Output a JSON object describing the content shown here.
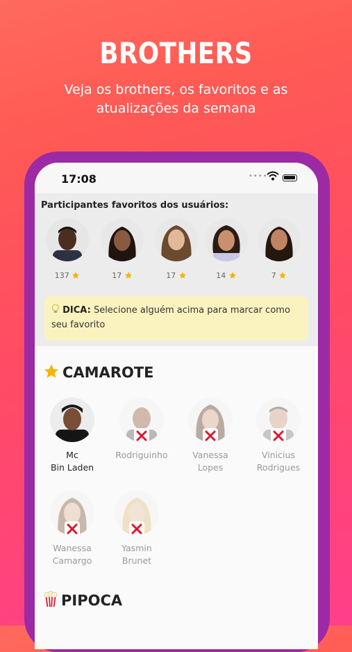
{
  "hero": {
    "title": "BROTHERS",
    "subtitle": "Veja os brothers, os favoritos e as atualizações da semana"
  },
  "status_bar": {
    "time": "17:08",
    "icons": [
      "wifi-icon",
      "battery-icon"
    ]
  },
  "favorites": {
    "title": "Participantes favoritos dos usuários:",
    "items": [
      {
        "count": "137",
        "icon": "star-icon"
      },
      {
        "count": "17",
        "icon": "star-icon"
      },
      {
        "count": "17",
        "icon": "star-icon"
      },
      {
        "count": "14",
        "icon": "star-icon"
      },
      {
        "count": "7",
        "icon": "star-icon"
      }
    ]
  },
  "tip": {
    "icon": "lightbulb-icon",
    "prefix": "DICA:",
    "text": " Selecione alguém acima para marcar como seu favorito"
  },
  "camarote": {
    "icon": "star-icon",
    "title": "CAMAROTE",
    "members": [
      {
        "name": "Mc\nBin Laden",
        "eliminated": false
      },
      {
        "name": "Rodriguinho",
        "eliminated": true
      },
      {
        "name": "Vanessa\nLopes",
        "eliminated": true
      },
      {
        "name": "Vinicius\nRodrigues",
        "eliminated": true
      },
      {
        "name": "Wanessa\nCamargo",
        "eliminated": true
      },
      {
        "name": "Yasmin\nBrunet",
        "eliminated": true
      }
    ]
  },
  "pipoca": {
    "icon": "popcorn-icon",
    "title": "PIPOCA"
  },
  "colors": {
    "background_top": "#ff6a5c",
    "background_bottom": "#ff3f8a",
    "phone_frame": "#9c2aa5",
    "tip_background": "#fbf3bf",
    "eliminated_mark": "#e0162b",
    "star": "#f5b301"
  }
}
